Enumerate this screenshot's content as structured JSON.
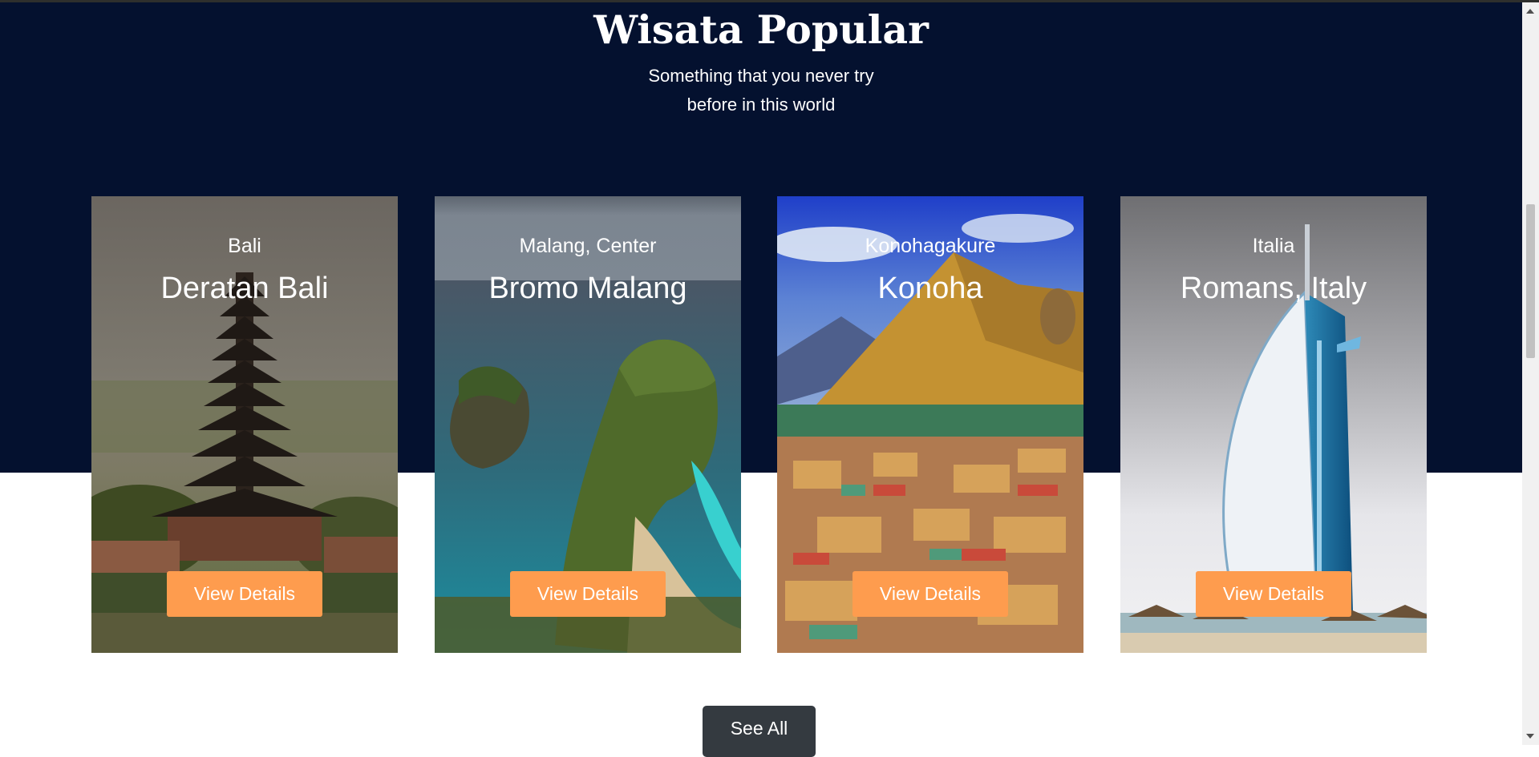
{
  "section": {
    "title": "Wisata Popular",
    "subtitle_line1": "Something that you never try",
    "subtitle_line2": "before in this world"
  },
  "cards": [
    {
      "region": "Bali",
      "name": "Deratan Bali",
      "button": "View Details"
    },
    {
      "region": "Malang, Center",
      "name": "Bromo Malang",
      "button": "View Details"
    },
    {
      "region": "Konohagakure",
      "name": "Konoha",
      "button": "View Details"
    },
    {
      "region": "Italia",
      "name": "Romans, Italy",
      "button": "View Details"
    }
  ],
  "see_all": {
    "label": "See All"
  },
  "colors": {
    "hero_background": "#04112f",
    "button_accent": "#fe9c4e",
    "see_all_background": "#343a40"
  }
}
